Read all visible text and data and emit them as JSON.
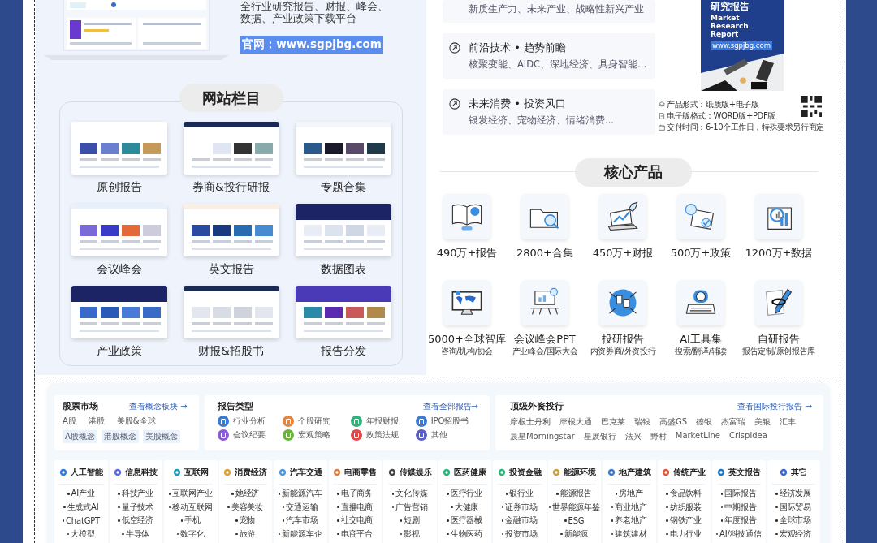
{
  "intro": {
    "description": "全行业研究报告、财报、峰会、数据、产业政策下载平台",
    "website_button": "官网：www.sgpjbg.com"
  },
  "website_sections": {
    "heading": "网站栏目",
    "items": [
      {
        "label": "原创报告"
      },
      {
        "label": "券商&投行研报"
      },
      {
        "label": "专题合集"
      },
      {
        "label": "会议峰会"
      },
      {
        "label": "英文报告"
      },
      {
        "label": "数据图表"
      },
      {
        "label": "产业政策"
      },
      {
        "label": "财报&招股书"
      },
      {
        "label": "报告分发"
      }
    ]
  },
  "feature_cards": [
    {
      "description": "新质生产力、未来产业、战略性新兴产业"
    },
    {
      "title": "前沿技术 • 趋势前瞻",
      "description": "核聚变能、AIDC、深地经济、具身智能..."
    },
    {
      "title": "未来消费 • 投资风口",
      "description": "银发经济、宠物经济、情绪消费..."
    }
  ],
  "cover": {
    "title": "研究报告",
    "subtitle": "Market Research Report",
    "url": "www.sgpjbg.com"
  },
  "product_info": [
    {
      "kind": "form",
      "text": "产品形式：纸质版+电子版"
    },
    {
      "kind": "file",
      "text": "电子版格式：WORD版+PDF版"
    },
    {
      "kind": "time",
      "text": "交付时间：6-10个工作日，特殊要求另行商定"
    }
  ],
  "core_products": {
    "heading": "核心产品",
    "items": [
      {
        "label": "490万+报告"
      },
      {
        "label": "2800+合集"
      },
      {
        "label": "450万+财报"
      },
      {
        "label": "500万+政策"
      },
      {
        "label": "1200万+数据"
      },
      {
        "label": "5000+全球智库",
        "subtitle": "咨询/机构/协会"
      },
      {
        "label": "会议峰会PPT",
        "subtitle": "产业峰会/国际大会"
      },
      {
        "label": "投研报告",
        "subtitle": "内资券商/外资投行"
      },
      {
        "label": "AI工具集",
        "subtitle": "搜索/翻译/辅读"
      },
      {
        "label": "自研报告",
        "subtitle": "报告定制/原创报告库"
      }
    ]
  },
  "stock_market": {
    "title": "股票市场",
    "link": "查看概念板块 →",
    "markets": [
      "A股",
      "港股",
      "美股&全球"
    ],
    "concepts": [
      "A股概念",
      "港股概念",
      "美股概念"
    ]
  },
  "report_types": {
    "title": "报告类型",
    "link": "查看全部报告→",
    "items": [
      {
        "label": "行业分析",
        "color": "#3a7bd5"
      },
      {
        "label": "个股研究",
        "color": "#e8853a"
      },
      {
        "label": "年报财报",
        "color": "#2bb57a"
      },
      {
        "label": "IPO招股书",
        "color": "#3a7bd5"
      },
      {
        "label": "会议纪要",
        "color": "#8a5cd6"
      },
      {
        "label": "宏观策略",
        "color": "#6bb33a"
      },
      {
        "label": "政策法规",
        "color": "#e04848"
      },
      {
        "label": "其他",
        "color": "#5a5fc8"
      }
    ]
  },
  "investment_banks": {
    "title": "顶级外资投行",
    "link": "查看国际投行报告 →",
    "banks": [
      "摩根士丹利",
      "摩根大通",
      "巴克莱",
      "瑞银",
      "高盛GS",
      "德银",
      "杰富瑞",
      "美银",
      "汇丰",
      "晨星Morningstar",
      "星展银行",
      "法兴",
      "野村",
      "MarketLine",
      "Crispidea"
    ]
  },
  "industries": [
    {
      "title": "人工智能",
      "items": [
        "AI产业",
        "生成式AI",
        "ChatGPT",
        "大模型"
      ]
    },
    {
      "title": "信息科技",
      "items": [
        "科技产业",
        "量子技术",
        "低空经济",
        "半导体"
      ]
    },
    {
      "title": "互联网",
      "items": [
        "互联网产业",
        "移动互联网",
        "手机",
        "数字化"
      ]
    },
    {
      "title": "消费经济",
      "items": [
        "她经济",
        "美容美妆",
        "宠物",
        "旅游"
      ]
    },
    {
      "title": "汽车交通",
      "items": [
        "新能源汽车",
        "交通运输",
        "汽车市场",
        "新能源车企"
      ]
    },
    {
      "title": "电商零售",
      "items": [
        "电子商务",
        "直播电商",
        "社交电商",
        "电商平台"
      ]
    },
    {
      "title": "传媒娱乐",
      "items": [
        "文化传媒",
        "广告营销",
        "短剧",
        "影视"
      ]
    },
    {
      "title": "医药健康",
      "items": [
        "医疗行业",
        "大健康",
        "医疗器械",
        "生物医药"
      ]
    },
    {
      "title": "投资金融",
      "items": [
        "银行业",
        "证券市场",
        "金融市场",
        "投资市场"
      ]
    },
    {
      "title": "能源环境",
      "items": [
        "能源报告",
        "世界能源年鉴",
        "ESG",
        "新能源"
      ]
    },
    {
      "title": "地产建筑",
      "items": [
        "房地产",
        "商业地产",
        "养老地产",
        "建筑建材"
      ]
    },
    {
      "title": "传统产业",
      "items": [
        "食品饮料",
        "纺织服装",
        "钢铁产业",
        "电力行业"
      ]
    },
    {
      "title": "英文报告",
      "items": [
        "国际报告",
        "中期报告",
        "年度报告",
        "AI/科技通信"
      ]
    },
    {
      "title": "其它",
      "items": [
        "经济发展",
        "国际贸易",
        "全球市场",
        "宏观经济"
      ]
    }
  ]
}
